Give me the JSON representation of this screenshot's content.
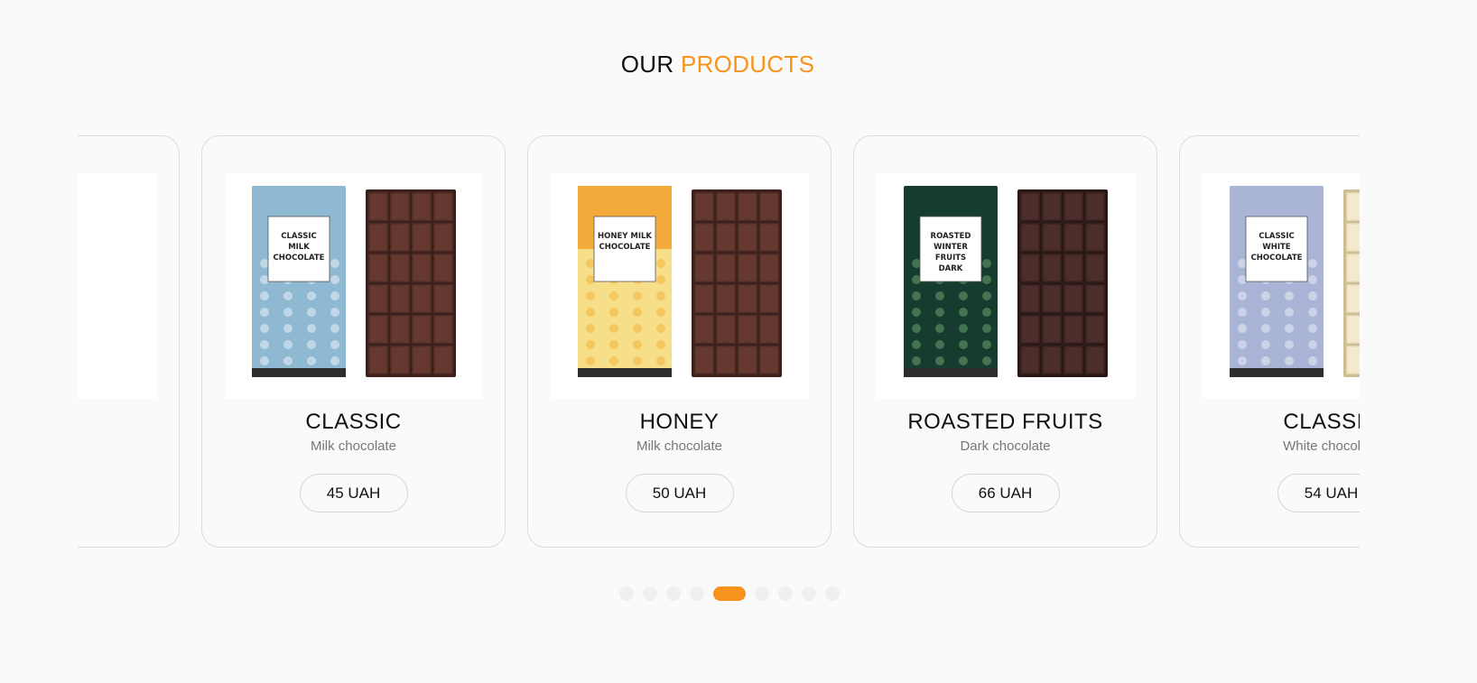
{
  "section": {
    "title_part1": "OUR",
    "title_part2": "PRODUCTS"
  },
  "colors": {
    "accent": "#f7941d",
    "background": "#fafafa",
    "card_border": "#dcdcdc"
  },
  "products": [
    {
      "name": "",
      "type": "",
      "price": "",
      "wrapper": "brown",
      "wrapper_label": "",
      "bar": "dark",
      "icon": "chocolate-bar-icon"
    },
    {
      "name": "CLASSIC",
      "type": "Milk chocolate",
      "price": "45 UAH",
      "wrapper": "blue",
      "wrapper_label": "CLASSIC MILK CHOCOLATE",
      "bar": "milk",
      "icon": "milk-chocolate-bar-icon"
    },
    {
      "name": "HONEY",
      "type": "Milk chocolate",
      "price": "50 UAH",
      "wrapper": "honey",
      "wrapper_label": "HONEY MILK CHOCOLATE",
      "bar": "milk",
      "icon": "honey-chocolate-bar-icon"
    },
    {
      "name": "ROASTED FRUITS",
      "type": "Dark chocolate",
      "price": "66 UAH",
      "wrapper": "green",
      "wrapper_label": "ROASTED WINTER FRUITS DARK CHOCOLATE",
      "bar": "dark",
      "icon": "dark-chocolate-bar-icon"
    },
    {
      "name": "CLASSIC",
      "type": "White chocolate",
      "price": "54 UAH",
      "wrapper": "lavender",
      "wrapper_label": "CLASSIC WHITE CHOCOLATE",
      "bar": "white",
      "icon": "white-chocolate-bar-icon"
    }
  ],
  "pagination": {
    "count": 9,
    "active_index": 4
  }
}
